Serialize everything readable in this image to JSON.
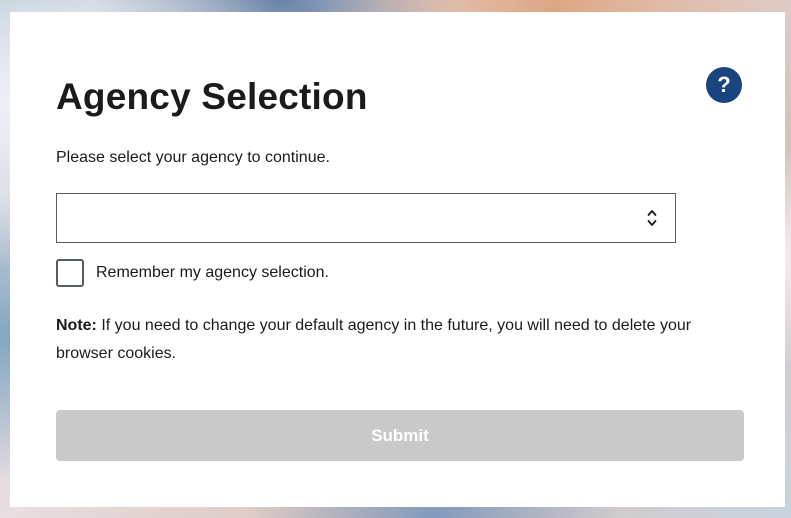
{
  "dialog": {
    "title": "Agency Selection",
    "help_label": "?",
    "instructions": "Please select your agency to continue.",
    "agency_select": {
      "value": "",
      "icon": "updown-chevron-icon"
    },
    "remember": {
      "label": "Remember my agency selection.",
      "checked": false
    },
    "note": {
      "prefix": "Note:",
      "text": " If you need to change your default agency in the future, you will need to delete your browser cookies."
    },
    "submit_label": "Submit",
    "submit_disabled": true
  },
  "colors": {
    "help_button": "#1a4480",
    "submit_disabled": "#c9c9c9",
    "text": "#1b1b1b",
    "border": "#565c65"
  }
}
